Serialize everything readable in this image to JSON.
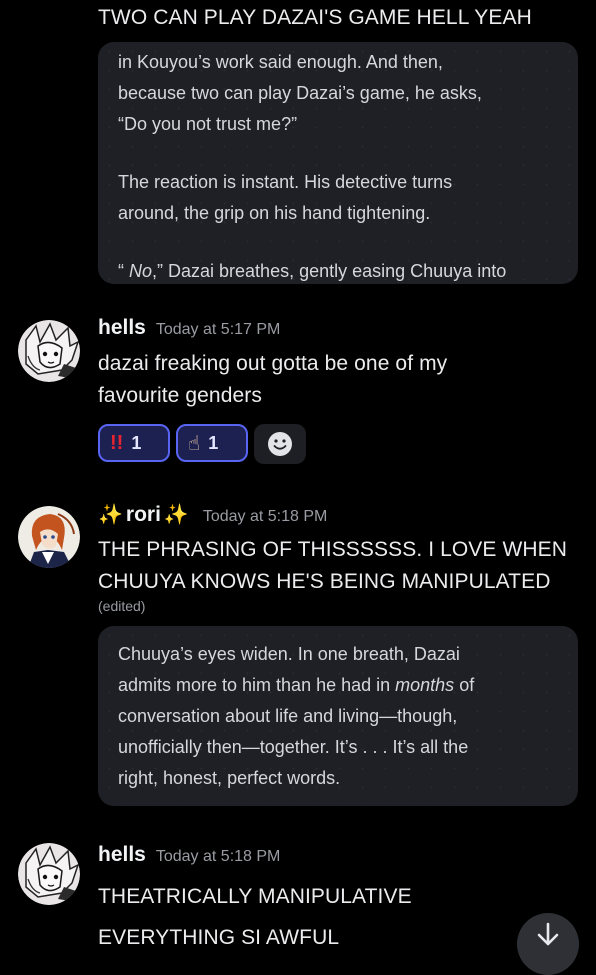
{
  "messages": {
    "top_text": "TWO CAN PLAY DAZAI'S GAME HELL YEAH",
    "embed1": {
      "lines": [
        "in Kouyou’s work said enough. And then,",
        "because two can play Dazai’s game, he asks,",
        "“Do you not trust me?”",
        "The reaction is instant. His detective turns",
        "around, the grip on his hand tightening."
      ],
      "last_line_open": "“ ",
      "last_line_italic": "No",
      "last_line_rest": ",” Dazai breathes, gently easing Chuuya into"
    },
    "msg1": {
      "author": "hells",
      "time": "Today at 5:17 PM",
      "lines": [
        "dazai freaking out gotta be one of my",
        "favourite genders"
      ],
      "reactions": [
        {
          "emoji": "!!",
          "count": "1"
        },
        {
          "emoji": "☝",
          "count": "1"
        }
      ]
    },
    "msg2": {
      "author": "rori",
      "author_sparkle": "✨",
      "time": "Today at 5:18 PM",
      "lines": [
        "THE PHRASING OF THISSSSSS. I LOVE WHEN",
        "CHUUYA KNOWS HE'S BEING MANIPULATED"
      ],
      "edited": "(edited)",
      "embed": {
        "line1": "Chuuya’s eyes widen. In one breath, Dazai",
        "line2_a": "admits more to him than he had in ",
        "line2_italic": "months",
        "line2_b": " of",
        "line3": "conversation about life and living—though,",
        "line4": "unofficially then—together. It’s . . . It’s all the",
        "line5": "right, honest, perfect words."
      }
    },
    "msg3": {
      "author": "hells",
      "time": "Today at 5:18 PM",
      "lines": [
        "THEATRICALLY MANIPULATIVE",
        "EVERYTHING SI AWFUL"
      ]
    }
  },
  "icons": {
    "add_reaction": "smiley-face-icon",
    "scroll_down": "arrow-down-icon"
  },
  "colors": {
    "background": "#000000",
    "embed": "#1f2026",
    "reaction_border": "#5865f2",
    "reaction_bg": "#1c2152"
  }
}
